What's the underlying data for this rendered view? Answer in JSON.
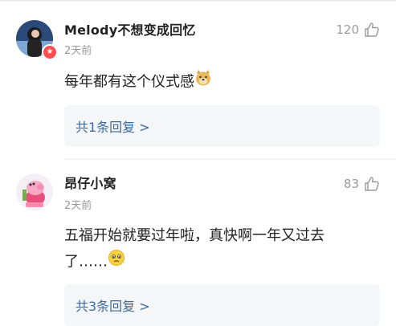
{
  "comments": [
    {
      "username": "Melody不想变成回忆",
      "time": "2天前",
      "likes": "120",
      "text": "每年都有这个仪式感",
      "emoji": "doge-emoji",
      "reply_link": "共1条回复 >"
    },
    {
      "username": "昂仔小窝",
      "time": "2天前",
      "likes": "83",
      "text_line1": "五福开始就要过年啦，真快啊一年又过去",
      "text_line2": "了……",
      "emoji": "worried-face-emoji",
      "reply_link": "共3条回复 >"
    }
  ],
  "colors": {
    "reply_link": "#3d6a9e",
    "muted": "#9a9a9a",
    "reply_bg": "#f5f6f8",
    "badge": "#ff4d4f"
  }
}
